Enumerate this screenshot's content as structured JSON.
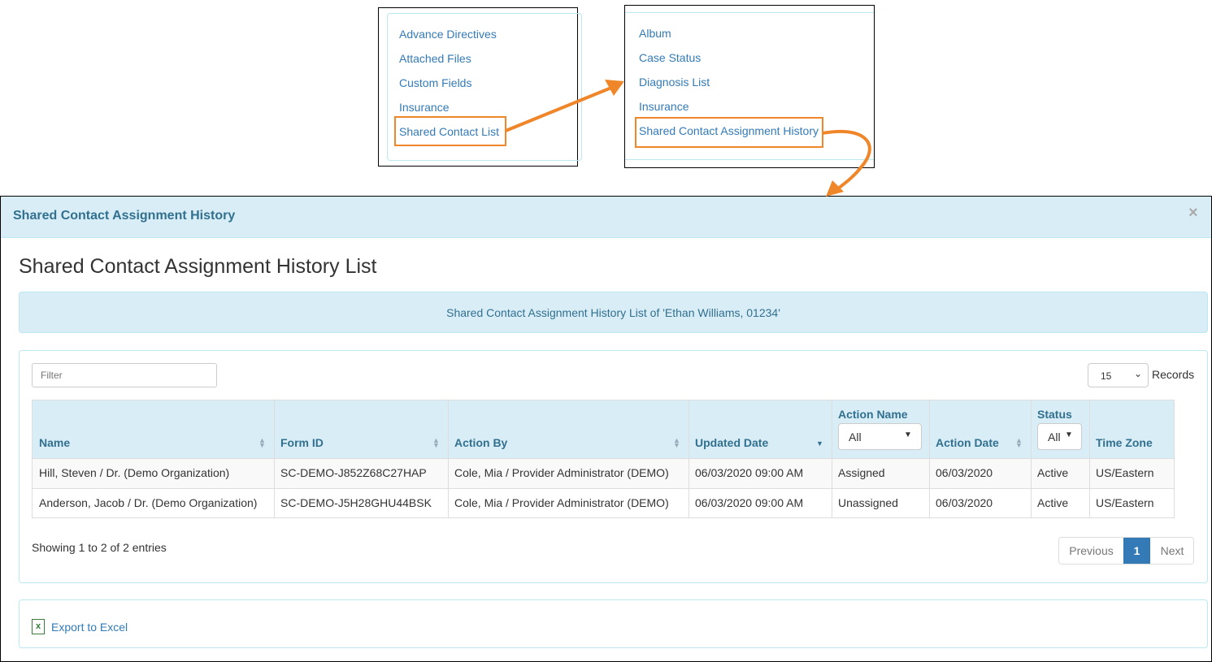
{
  "menu_left": {
    "items": [
      "Advance Directives",
      "Attached Files",
      "Custom Fields",
      "Insurance",
      "Shared Contact List"
    ],
    "highlighted": "Shared Contact List"
  },
  "menu_right": {
    "items": [
      "Album",
      "Case Status",
      "Diagnosis List",
      "Insurance",
      "Shared Contact Assignment History"
    ],
    "highlighted": "Shared Contact Assignment History"
  },
  "colors": {
    "annotation": "#f0862a",
    "link": "#337ab7",
    "header_bg": "#d9edf7",
    "header_text": "#31708f",
    "active_page": "#337ab7"
  },
  "modal": {
    "title": "Shared Contact Assignment History",
    "close": "×",
    "heading": "Shared Contact Assignment History List",
    "info": "Shared Contact Assignment History List of 'Ethan Williams, 01234'",
    "filter_placeholder": "Filter",
    "records_value": "15",
    "records_label": "Records",
    "columns": [
      "Name",
      "Form ID",
      "Action By",
      "Updated Date",
      "Action Name",
      "Action Date",
      "Status",
      "Time Zone"
    ],
    "action_name_filter": "All",
    "status_filter": "All",
    "rows": [
      [
        "Hill, Steven / Dr. (Demo Organization)",
        "SC-DEMO-J852Z68C27HAP",
        "Cole, Mia / Provider Administrator (DEMO)",
        "06/03/2020 09:00 AM",
        "Assigned",
        "06/03/2020",
        "Active",
        "US/Eastern"
      ],
      [
        "Anderson, Jacob / Dr. (Demo Organization)",
        "SC-DEMO-J5H28GHU44BSK",
        "Cole, Mia / Provider Administrator (DEMO)",
        "06/03/2020 09:00 AM",
        "Unassigned",
        "06/03/2020",
        "Active",
        "US/Eastern"
      ]
    ],
    "showing": "Showing 1 to 2 of 2 entries",
    "pagination": {
      "previous": "Previous",
      "current": "1",
      "next": "Next"
    },
    "export": "Export to Excel"
  }
}
